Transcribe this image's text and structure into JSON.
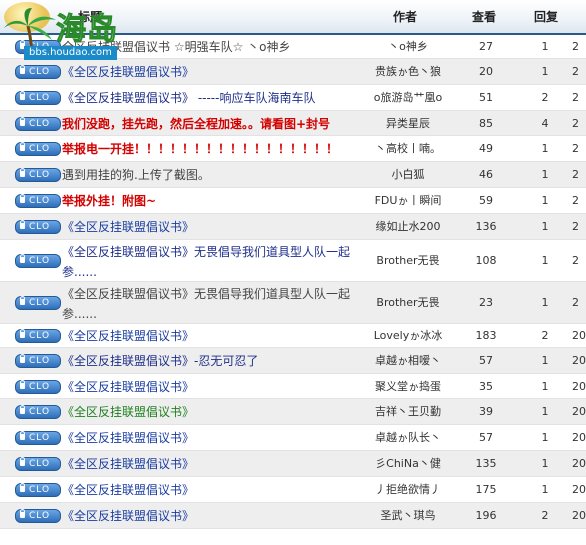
{
  "watermark": {
    "brand": "海岛",
    "url": "bbs.houdao.com"
  },
  "columns": {
    "title": "标题",
    "author": "作者",
    "views": "查看",
    "replies": "回复"
  },
  "badge_label": "CLO",
  "rows": [
    {
      "title": "全区反挂联盟倡议书 ☆明强车队☆ 丶o神乡",
      "color": "gray",
      "author": "丶o神乡",
      "views": "27",
      "replies": "1",
      "last": "2"
    },
    {
      "title": "《全区反挂联盟倡议书》",
      "color": "blue",
      "author": "贵族ゕ色丶狼",
      "views": "20",
      "replies": "1",
      "last": "2"
    },
    {
      "title": "《全区反挂联盟倡议书》 -----响应车队海南车队",
      "color": "navy",
      "author": "o旅游岛艹凰o",
      "views": "51",
      "replies": "2",
      "last": "2"
    },
    {
      "title": "我们没跑，挂先跑，然后全程加速。。请看图+封号",
      "color": "red",
      "author": "异类星辰",
      "views": "85",
      "replies": "4",
      "last": "2"
    },
    {
      "title": "举报电一开挂！！！！！！！！！！！！！！！！！",
      "color": "red",
      "author": "丶高校丨喃。",
      "views": "49",
      "replies": "1",
      "last": "2"
    },
    {
      "title": "遇到用挂的狗.上传了截图。",
      "color": "gray",
      "author": "小白狐",
      "views": "46",
      "replies": "1",
      "last": "2"
    },
    {
      "title": "举报外挂！附图~",
      "color": "red",
      "author": "FDUゕ丨瞬间",
      "views": "59",
      "replies": "1",
      "last": "2"
    },
    {
      "title": "《全区反挂联盟倡议书》",
      "color": "blue",
      "author": "缘如止水200",
      "views": "136",
      "replies": "1",
      "last": "2"
    },
    {
      "title": "《全区反挂联盟倡议书》无畏倡导我们道具型人队一起参......",
      "color": "navy",
      "author": "Brother无畏",
      "views": "108",
      "replies": "1",
      "last": "2"
    },
    {
      "title": "《全区反挂联盟倡议书》无畏倡导我们道具型人队一起参......",
      "color": "gray",
      "author": "Brother无畏",
      "views": "23",
      "replies": "1",
      "last": "2"
    },
    {
      "title": "《全区反挂联盟倡议书》",
      "color": "blue",
      "author": "Lovelyゕ冰冰",
      "views": "183",
      "replies": "2",
      "last": "20"
    },
    {
      "title": "《全区反挂联盟倡议书》-忍无可忍了",
      "color": "navy",
      "author": "卓越ゕ相嗳丶",
      "views": "57",
      "replies": "1",
      "last": "20"
    },
    {
      "title": "《全区反挂联盟倡议书》",
      "color": "blue",
      "author": "聚义堂ゕ捣蛋",
      "views": "35",
      "replies": "1",
      "last": "20"
    },
    {
      "title": "《全区反挂联盟倡议书》",
      "color": "green",
      "author": "吉祥丶王贝勤",
      "views": "39",
      "replies": "1",
      "last": "20"
    },
    {
      "title": "《全区反挂联盟倡议书》",
      "color": "blue",
      "author": "卓越ゕ队长丶",
      "views": "57",
      "replies": "1",
      "last": "20"
    },
    {
      "title": "《全区反挂联盟倡议书》",
      "color": "blue",
      "author": "彡ChiNa丶健",
      "views": "135",
      "replies": "1",
      "last": "20"
    },
    {
      "title": "《全区反挂联盟倡议书》",
      "color": "blue",
      "author": "丿拒绝欲情丿",
      "views": "175",
      "replies": "1",
      "last": "20"
    },
    {
      "title": "《全区反挂联盟倡议书》",
      "color": "blue",
      "author": "圣武丶琪鸟",
      "views": "196",
      "replies": "2",
      "last": "20"
    }
  ]
}
